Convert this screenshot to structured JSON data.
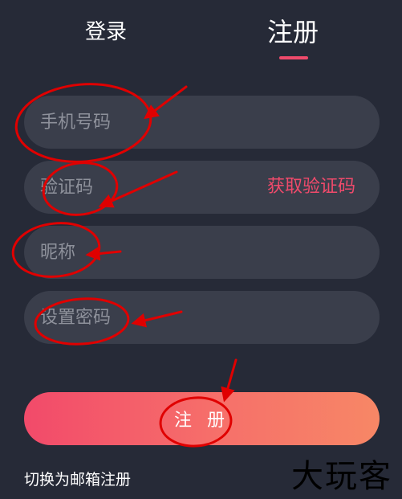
{
  "tabs": {
    "login": "登录",
    "register": "注册"
  },
  "form": {
    "phone_placeholder": "手机号码",
    "code_placeholder": "验证码",
    "get_code": "获取验证码",
    "nickname_placeholder": "昵称",
    "password_placeholder": "设置密码",
    "submit": "注 册"
  },
  "switch_email": "切换为邮箱注册",
  "watermark": "大玩客",
  "colors": {
    "background": "#262a37",
    "field": "#3a3e4b",
    "accent": "#ef4a6b",
    "annotation": "#e00000"
  }
}
